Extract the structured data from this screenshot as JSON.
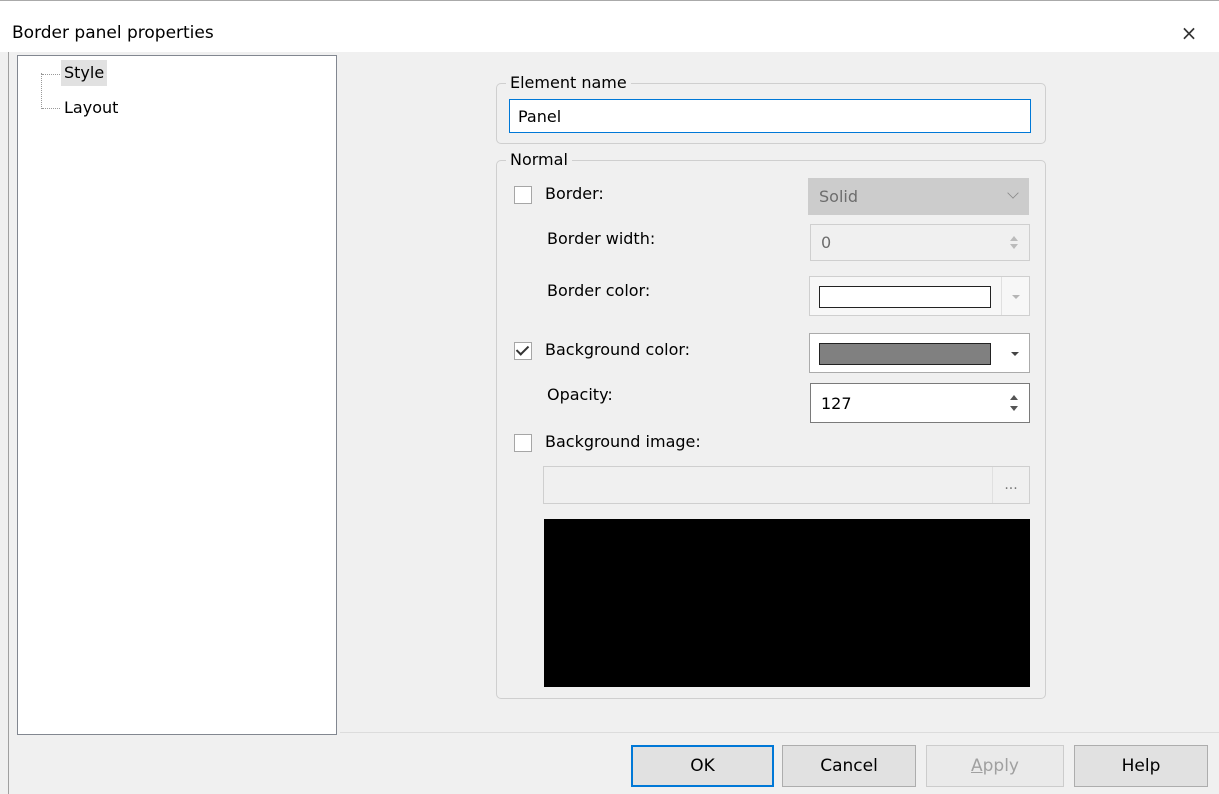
{
  "window": {
    "title": "Border panel properties",
    "close_glyph": "×"
  },
  "tree": {
    "items": [
      {
        "label": "Style",
        "selected": true
      },
      {
        "label": "Layout",
        "selected": false
      }
    ]
  },
  "element_name": {
    "legend": "Element name",
    "value": "Panel"
  },
  "normal": {
    "legend": "Normal",
    "border": {
      "label": "Border:",
      "checked": false,
      "style_value": "Solid"
    },
    "border_width": {
      "label": "Border width:",
      "value": "0"
    },
    "border_color": {
      "label": "Border color:",
      "color": "#ffffff"
    },
    "background_color": {
      "label": "Background color:",
      "checked": true,
      "color": "#808080"
    },
    "opacity": {
      "label": "Opacity:",
      "value": "127"
    },
    "background_image": {
      "label": "Background image:",
      "checked": false,
      "path_value": "",
      "browse_label": "..."
    },
    "preview_color": "#000000"
  },
  "buttons": {
    "ok": "OK",
    "cancel": "Cancel",
    "apply_accel": "A",
    "apply_rest": "pply",
    "help": "Help"
  },
  "colors": {
    "accent": "#0078d7",
    "dialog_bg": "#f0f0f0"
  }
}
